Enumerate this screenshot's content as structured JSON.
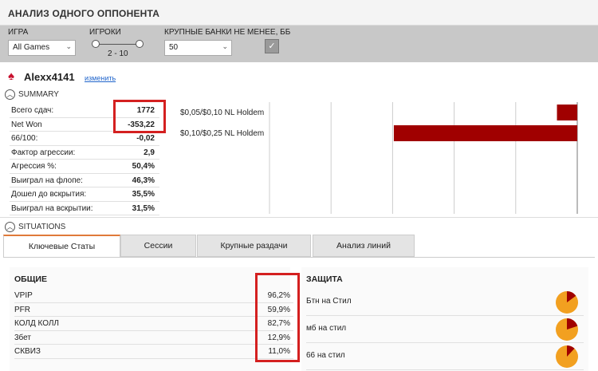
{
  "header": {
    "title": "АНАЛИЗ ОДНОГО ОППОНЕНТА"
  },
  "filters": {
    "game_label": "ИГРА",
    "game_value": "All Games",
    "players_label": "ИГРОКИ",
    "players_range": "2 - 10",
    "bigpots_label": "КРУПНЫЕ БАНКИ НЕ МЕНЕЕ, ББ",
    "bigpots_value": "50",
    "apply_icon": "checkmark-icon"
  },
  "player": {
    "name": "Alexx4141",
    "edit_label": "изменить",
    "site_icon": "pokerstars-icon"
  },
  "summary": {
    "label": "SUMMARY",
    "rows": [
      {
        "k": "Всего сдач:",
        "v": "1772"
      },
      {
        "k": "Net Won",
        "v": "-353,22"
      },
      {
        "k": "66/100:",
        "v": "-0,02"
      },
      {
        "k": "Фактор агрессии:",
        "v": "2,9"
      },
      {
        "k": "Агрессия %:",
        "v": "50,4%"
      },
      {
        "k": "Выиграл на флопе:",
        "v": "46,3%"
      },
      {
        "k": "Дошел до вскрытия:",
        "v": "35,5%"
      },
      {
        "k": "Выиграл на вскрытии:",
        "v": "31,5%"
      }
    ]
  },
  "chart_data": {
    "type": "bar",
    "orientation": "horizontal",
    "categories": [
      "$0,05/$0,10 NL Holdem",
      "$0,10/$0,25 NL Holdem"
    ],
    "values": [
      -33,
      -298
    ],
    "xlim": [
      -500,
      0
    ],
    "grid": true,
    "bar_color": "#a00000"
  },
  "situations": {
    "label": "SITUATIONS",
    "tabs": [
      "Ключевые Статы",
      "Сессии",
      "Крупные раздачи",
      "Анализ линий"
    ],
    "general": {
      "title": "ОБЩИЕ",
      "rows": [
        {
          "k": "VPIP",
          "v": "96,2%"
        },
        {
          "k": "PFR",
          "v": "59,9%"
        },
        {
          "k": "КОЛД КОЛЛ",
          "v": "82,7%"
        },
        {
          "k": "3бет",
          "v": "12,9%"
        },
        {
          "k": "СКВИЗ",
          "v": "11,0%"
        }
      ]
    },
    "defense": {
      "title": "ЗАЩИТА",
      "rows": [
        {
          "k": "Бтн на Стил",
          "pie": 0.15
        },
        {
          "k": "мб на стил",
          "pie": 0.2
        },
        {
          "k": "66 на стил",
          "pie": 0.12
        }
      ]
    }
  },
  "colors": {
    "accent": "#e07a3a",
    "highlight": "#d42020",
    "bar": "#a00000",
    "pie_main": "#f2a020",
    "pie_slice": "#a00000"
  }
}
